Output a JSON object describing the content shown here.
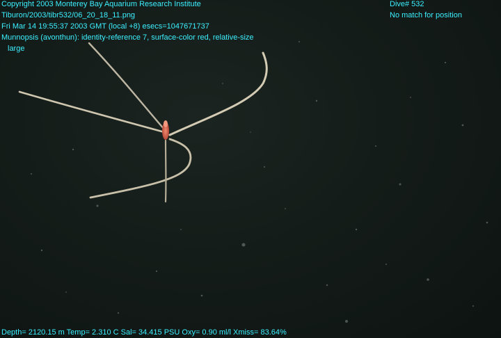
{
  "overlay": {
    "copyright": "Copyright 2003 Monterey Bay Aquarium Research Institute",
    "image_path": "Tiburon/2003/tibr532/06_20_18_11.png",
    "timestamp": "Fri Mar 14 19:55:37 2003 GMT (local +8)  esecs=1047671737",
    "annotation_line1": "Munnopsis (avonthun): identity-reference 7, surface-color red, relative-size",
    "annotation_line2": "large",
    "dive": "Dive# 532",
    "position_status": "No match for position",
    "telemetry": "Depth= 2120.15 m  Temp= 2.310 C  Sal= 34.415 PSU  Oxy= 0.90 ml/l  Xmiss= 83.64%"
  },
  "colors": {
    "overlay_text": "#3cf0ff",
    "water": "#141c19",
    "specimen_legs": "#cfc6b0",
    "specimen_body": "#e06a50"
  }
}
